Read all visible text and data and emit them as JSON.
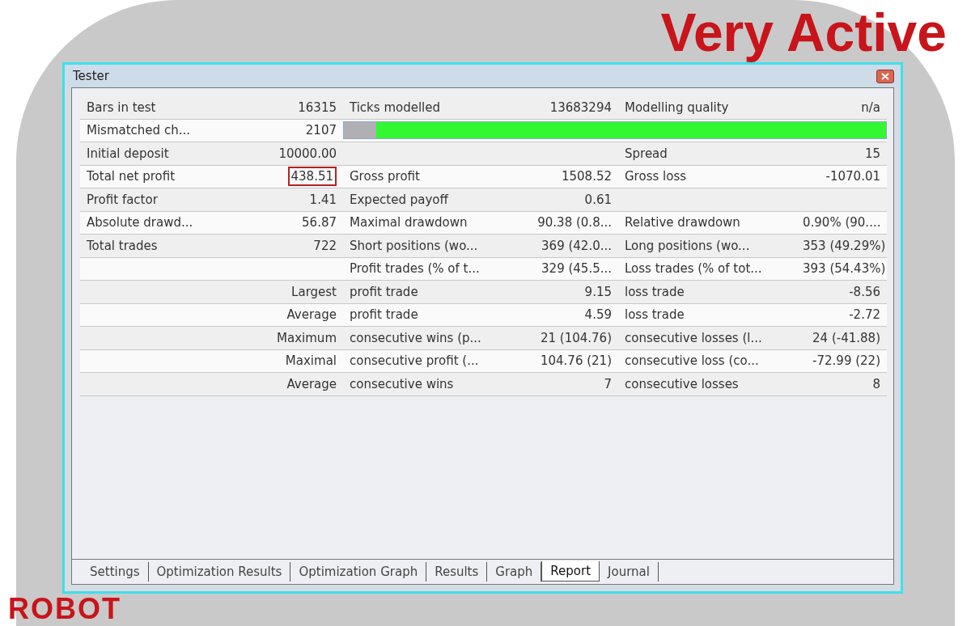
{
  "poster": {
    "headline": "Very Active",
    "footer_word": "ROBOT"
  },
  "window": {
    "title": "Tester"
  },
  "report": {
    "rows": [
      {
        "label_a": "Bars in test",
        "value_a": "16315",
        "label_b": "Ticks modelled",
        "value_b": "13683294",
        "label_c": "Modelling quality",
        "value_c": "n/a"
      },
      {
        "label_a": "Mismatched ch...",
        "value_a": "2107",
        "quality_bar": {
          "level": 0.94
        }
      },
      {
        "label_a": "Initial deposit",
        "value_a": "10000.00",
        "label_c": "Spread",
        "value_c": "15"
      },
      {
        "label_a": "Total net profit",
        "value_a": "438.51",
        "value_a_boxed": true,
        "label_b": "Gross profit",
        "value_b": "1508.52",
        "label_c": "Gross loss",
        "value_c": "-1070.01"
      },
      {
        "label_a": "Profit factor",
        "value_a": "1.41",
        "label_b": "Expected payoff",
        "value_b": "0.61"
      },
      {
        "label_a": "Absolute drawd...",
        "value_a": "56.87",
        "label_b": "Maximal drawdown",
        "value_b": "90.38 (0.8...",
        "label_c": "Relative drawdown",
        "value_c": "0.90% (90...."
      },
      {
        "label_a": "Total trades",
        "value_a": "722",
        "label_b": "Short positions (wo...",
        "value_b": "369 (42.0...",
        "label_c": "Long positions (wo...",
        "value_c": "353 (49.29%)"
      },
      {
        "label_b": "Profit trades (% of t...",
        "value_b": "329 (45.5...",
        "label_c": "Loss trades (% of tot...",
        "value_c": "393 (54.43%)"
      },
      {
        "value_a": "Largest",
        "label_b": "profit trade",
        "value_b": "9.15",
        "label_c": "loss trade",
        "value_c": "-8.56"
      },
      {
        "value_a": "Average",
        "label_b": "profit trade",
        "value_b": "4.59",
        "label_c": "loss trade",
        "value_c": "-2.72"
      },
      {
        "value_a": "Maximum",
        "label_b": "consecutive wins (p...",
        "value_b": "21 (104.76)",
        "label_c": "consecutive losses (l...",
        "value_c": "24 (-41.88)"
      },
      {
        "value_a": "Maximal",
        "label_b": "consecutive profit (...",
        "value_b": "104.76 (21)",
        "label_c": "consecutive loss (co...",
        "value_c": "-72.99 (22)"
      },
      {
        "value_a": "Average",
        "label_b": "consecutive wins",
        "value_b": "7",
        "label_c": "consecutive losses",
        "value_c": "8"
      }
    ]
  },
  "tabs": [
    {
      "label": "Settings",
      "selected": false
    },
    {
      "label": "Optimization Results",
      "selected": false
    },
    {
      "label": "Optimization Graph",
      "selected": false
    },
    {
      "label": "Results",
      "selected": false
    },
    {
      "label": "Graph",
      "selected": false
    },
    {
      "label": "Report",
      "selected": true
    },
    {
      "label": "Journal",
      "selected": false
    }
  ]
}
